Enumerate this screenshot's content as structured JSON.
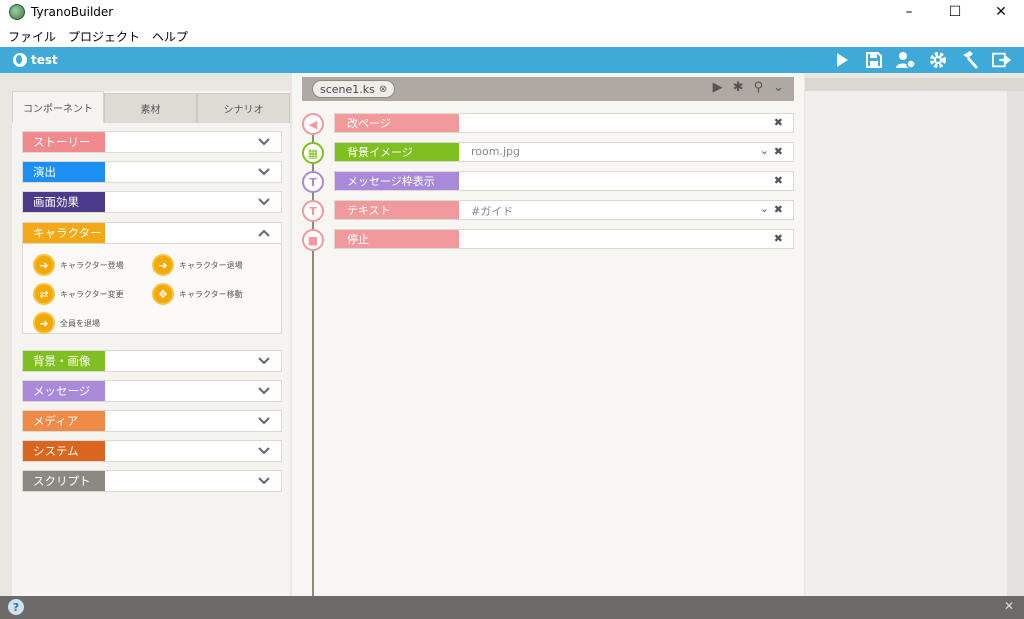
{
  "window": {
    "title": "TyranoBuilder",
    "minimize": "–",
    "maximize": "☐",
    "close": "✕"
  },
  "menu": [
    "ファイル",
    "プロジェクト",
    "ヘルプ"
  ],
  "project": {
    "name": "test"
  },
  "toolbar_icons": [
    "play-icon",
    "save-icon",
    "users-gear-icon",
    "gear-icon",
    "hammer-icon",
    "export-icon"
  ],
  "left_tabs": [
    {
      "label": "コンポーネント",
      "active": true
    },
    {
      "label": "素材",
      "active": false
    },
    {
      "label": "シナリオ",
      "active": false
    }
  ],
  "categories": [
    {
      "label": "ストーリー",
      "color": "#f08a8d"
    },
    {
      "label": "演出",
      "color": "#1d8ff2"
    },
    {
      "label": "画面効果",
      "color": "#4a3a8a"
    },
    {
      "label": "キャラクター",
      "color": "#f3a816"
    },
    {
      "label": "背景・画像",
      "color": "#7fbf1f"
    },
    {
      "label": "メッセージ",
      "color": "#a88ad9"
    },
    {
      "label": "メディア",
      "color": "#f08a47"
    },
    {
      "label": "システム",
      "color": "#d9651f"
    },
    {
      "label": "スクリプト",
      "color": "#8c8882"
    }
  ],
  "character_items": [
    {
      "label": "キャラクター登場"
    },
    {
      "label": "キャラクター退場"
    },
    {
      "label": "キャラクター変更"
    },
    {
      "label": "キャラクター移動"
    },
    {
      "label": "全員を退場"
    }
  ],
  "scene": {
    "tab_label": "scene1.ks"
  },
  "rows": [
    {
      "label": "改ページ",
      "value": "",
      "color": "#f2999b",
      "dropdown": false
    },
    {
      "label": "背景イメージ",
      "value": "room.jpg",
      "color": "#7fbf1f",
      "dropdown": true
    },
    {
      "label": "メッセージ枠表示",
      "value": "",
      "color": "#a88ad9",
      "dropdown": false
    },
    {
      "label": "テキスト",
      "value": "#ガイド",
      "color": "#f2999b",
      "dropdown": true
    },
    {
      "label": "停止",
      "value": "",
      "color": "#f2999b",
      "dropdown": false
    }
  ],
  "remove_glyph": "✖",
  "help_label": "?",
  "bottom_close": "✕"
}
